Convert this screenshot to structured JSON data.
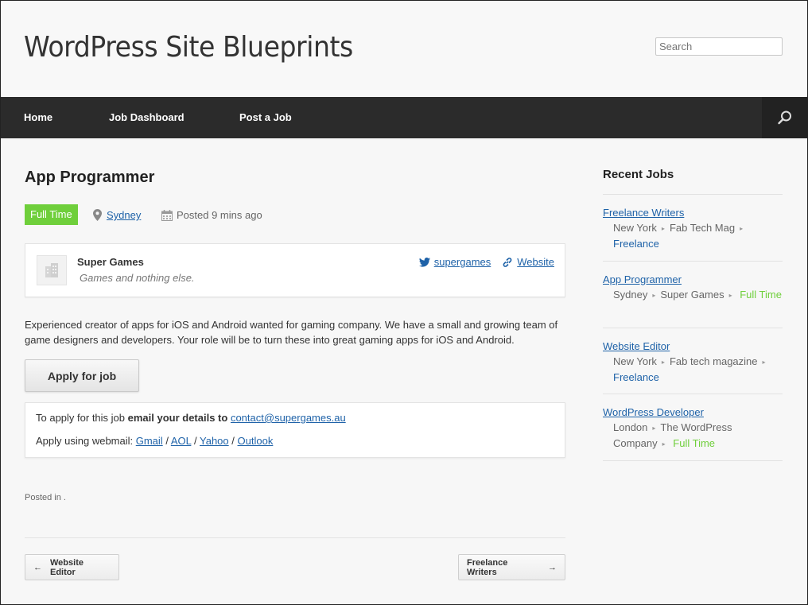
{
  "site": {
    "title": "WordPress Site Blueprints",
    "search_placeholder": "Search"
  },
  "nav": {
    "items": [
      "Home",
      "Job Dashboard",
      "Post a Job"
    ]
  },
  "job": {
    "title": "App Programmer",
    "type": "Full Time",
    "location": "Sydney",
    "posted": "Posted 9 mins ago",
    "company": {
      "name": "Super Games",
      "tagline": "Games and nothing else.",
      "twitter": "supergames",
      "website": "Website"
    },
    "description": "Experienced creator of apps for iOS and Android wanted for gaming company. We have a small and growing team of game designers and developers. Your role will be to turn these into great gaming apps for iOS and Android.",
    "apply_button": "Apply for job",
    "apply": {
      "line1_prefix": "To apply for this job ",
      "line1_bold": "email your details to",
      "email": "contact@supergames.au",
      "line2_prefix": "Apply using webmail: ",
      "webmail": [
        "Gmail",
        "AOL",
        "Yahoo",
        "Outlook"
      ],
      "separator": "/"
    },
    "posted_in": "Posted in ."
  },
  "post_nav": {
    "prev": "Website Editor",
    "next": "Freelance Writers",
    "prev_arrow": "←",
    "next_arrow": "→"
  },
  "sidebar": {
    "title": "Recent Jobs",
    "jobs": [
      {
        "title": "Freelance Writers",
        "location": "New York",
        "company": "Fab Tech Mag",
        "type": "Freelance"
      },
      {
        "title": "App Programmer",
        "location": "Sydney",
        "company": "Super Games",
        "type": "Full Time"
      },
      {
        "title": "Website Editor",
        "location": "New York",
        "company": "Fab tech magazine",
        "type": "Freelance"
      },
      {
        "title": "WordPress Developer",
        "location": "London",
        "company": "The WordPress Company",
        "type": "Full Time"
      }
    ]
  },
  "colors": {
    "accent": "#6fcf3b",
    "link": "#1e62a8",
    "navbar": "#2b2b2b"
  }
}
